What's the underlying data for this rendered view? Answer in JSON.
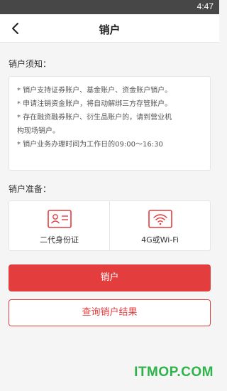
{
  "status_bar": {
    "time": "4:47"
  },
  "nav": {
    "title": "销户",
    "back_icon": "chevron-left-icon"
  },
  "notice": {
    "label": "销户须知：",
    "lines": [
      "* 销户支持证券账户、基金账户、资金账户销户。",
      "* 申请注销资金账户，将自动解绑三方存管账户。",
      "* 存在融资融券账户、衍生品账户的，请到营业机",
      "构现场销户。",
      "* 销户业务办理时间为工作日的09:00～16:30"
    ]
  },
  "prep": {
    "label": "销户准备：",
    "items": [
      {
        "label": "二代身份证",
        "icon": "id-card-icon"
      },
      {
        "label": "4G或Wi-Fi",
        "icon": "wifi-icon"
      }
    ]
  },
  "actions": {
    "primary_label": "销户",
    "secondary_label": "查询销户结果"
  },
  "watermark": "ITMOP.COM",
  "colors": {
    "accent": "#e33d3e",
    "status_bar": "#474747",
    "watermark": "#2db34a"
  }
}
